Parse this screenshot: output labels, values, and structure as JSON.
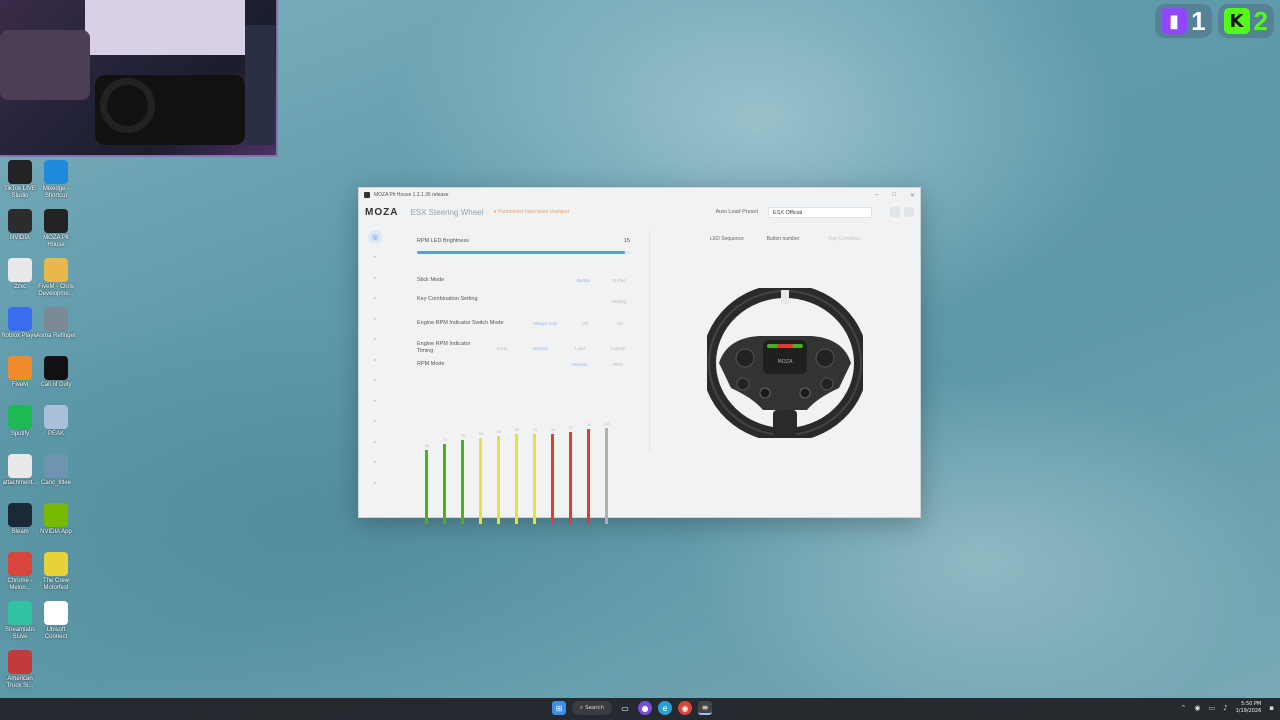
{
  "overlay": {
    "twitch_count": "1",
    "kick_count": "2",
    "colors": {
      "twitch": "#9146ff",
      "kick": "#53fc18"
    }
  },
  "desktop_icons": [
    {
      "label": "TikTok LIVE Studio",
      "icon": "tiktok-icon",
      "color": "#222"
    },
    {
      "label": "Mixedge - Shortcut",
      "icon": "edge-icon",
      "color": "#1f8ad9"
    },
    {
      "label": "NVIDIA",
      "icon": "nvidia-icon",
      "color": "#2c2c2c"
    },
    {
      "label": "MOZA Pit House",
      "icon": "moza-icon",
      "color": "#222"
    },
    {
      "label": "2zxc",
      "icon": "file-icon",
      "color": "#e9e9e9"
    },
    {
      "label": "FiveM - Chris Developme...",
      "icon": "folder-icon",
      "color": "#e8b84a"
    },
    {
      "label": "Roblox Player",
      "icon": "roblox-icon",
      "color": "#3a6cf0"
    },
    {
      "label": "Asma Refinger",
      "icon": "app-icon",
      "color": "#7a8a99"
    },
    {
      "label": "FiveM",
      "icon": "fivem-icon",
      "color": "#f08a2a"
    },
    {
      "label": "Call of Duty",
      "icon": "cod-icon",
      "color": "#111"
    },
    {
      "label": "Spotify",
      "icon": "spotify-icon",
      "color": "#1db954"
    },
    {
      "label": "PEAK",
      "icon": "peak-icon",
      "color": "#a8c0d8"
    },
    {
      "label": "attachment...",
      "icon": "file-icon",
      "color": "#e9e9e9"
    },
    {
      "label": "Canc_titlee",
      "icon": "image-icon",
      "color": "#6f93b0"
    },
    {
      "label": "Steam",
      "icon": "steam-icon",
      "color": "#1b2838"
    },
    {
      "label": "NVIDIA App",
      "icon": "nvidia-icon",
      "color": "#76b900"
    },
    {
      "label": "Chrome - Melon...",
      "icon": "chrome-icon",
      "color": "#d9463e"
    },
    {
      "label": "The Crew Motorfest",
      "icon": "crew-icon",
      "color": "#e8d23a"
    },
    {
      "label": "Streamlabs SLive",
      "icon": "streamlabs-icon",
      "color": "#31c3a2"
    },
    {
      "label": "Ubisoft Connect",
      "icon": "ubisoft-icon",
      "color": "#fff"
    },
    {
      "label": "American Truck Si...",
      "icon": "truck-icon",
      "color": "#c23a3a"
    }
  ],
  "app": {
    "window_title": "MOZA Pit House 1.3.1.36 release",
    "brand": "MOZA",
    "wheel_name": "ESX Steering Wheel",
    "unsaved_notice": "Parameters have been changed",
    "preset_label": "Auto Load Preset",
    "preset_value": "ESX Official",
    "sidebar_icons": [
      "steering-wheel-icon",
      "sliders-icon",
      "pedals-icon",
      "shifter-icon",
      "handbrake-icon",
      "lever-icon",
      "lever-icon",
      "gauge-icon",
      "dashboard-icon",
      "home-icon",
      "dash-icon",
      "gear-icon",
      "help-icon"
    ],
    "settings": {
      "brightness_label": "RPM LED Brightness",
      "brightness_value": "15",
      "brightness_fraction": 0.97,
      "stick_mode_label": "Stick Mode",
      "stick_mode_opts": [
        "Button",
        "D-Pad"
      ],
      "key_combo_label": "Key Combination Setting",
      "key_combo_btn": "Setting",
      "engine_switch_label": "Engine RPM Indicator Switch Mode",
      "engine_switch_opts": [
        "Always Auto",
        "Off",
        "On"
      ],
      "timing_label": "Engine RPM Indicator Timing",
      "timing_opts": [
        "Early",
        "Normal",
        "Later",
        "Custom"
      ],
      "rpm_mode_label": "RPM Mode",
      "rpm_mode_opts": [
        "Percent",
        "RPM"
      ]
    },
    "rpm_leds": [
      {
        "label": "65",
        "level": 0.74,
        "color": "#4caf1e"
      },
      {
        "label": "70",
        "level": 0.8,
        "color": "#4caf1e"
      },
      {
        "label": "75",
        "level": 0.84,
        "color": "#4caf1e"
      },
      {
        "label": "80",
        "level": 0.86,
        "color": "#e6e23a"
      },
      {
        "label": "85",
        "level": 0.88,
        "color": "#e6e23a"
      },
      {
        "label": "89",
        "level": 0.9,
        "color": "#e6e23a"
      },
      {
        "label": "93",
        "level": 0.9,
        "color": "#e6e23a"
      },
      {
        "label": "95",
        "level": 0.9,
        "color": "#e33b2e"
      },
      {
        "label": "97",
        "level": 0.92,
        "color": "#e33b2e"
      },
      {
        "label": "99",
        "level": 0.95,
        "color": "#e33b2e"
      },
      {
        "label": "100",
        "level": 0.96,
        "color": "#b0b0b0"
      }
    ],
    "right_tabs": [
      "LED Sequence",
      "Button number",
      "Key Combina..."
    ]
  },
  "taskbar": {
    "search_label": "Search",
    "time": "5:50 PM",
    "date": "1/19/2026"
  }
}
